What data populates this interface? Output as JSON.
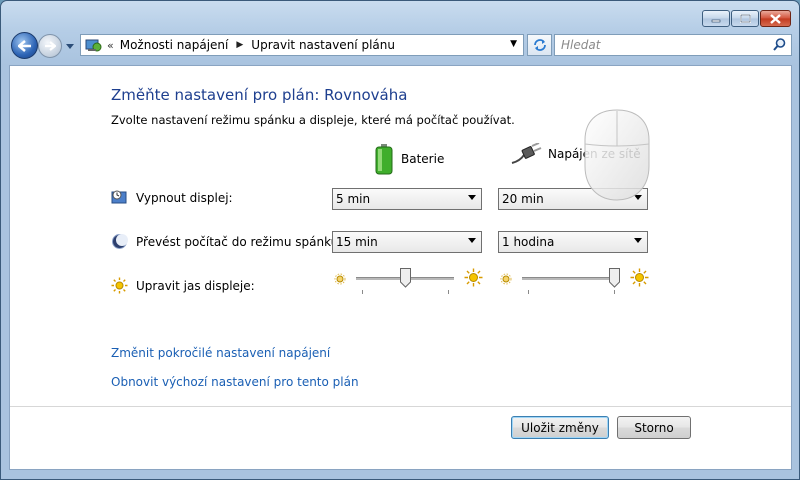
{
  "window": {
    "caption_buttons": [
      "minimize",
      "maximize",
      "close"
    ]
  },
  "navbar": {
    "address": {
      "overflow": "«",
      "crumbs": [
        "Možnosti napájení",
        "Upravit nastavení plánu"
      ]
    },
    "search_placeholder": "Hledat"
  },
  "main": {
    "title": "Změňte nastavení pro plán: Rovnováha",
    "subtitle": "Zvolte nastavení režimu spánku a displeje, které má počítač používat.",
    "columns": {
      "battery": "Baterie",
      "plugged_in": "Napájen ze sítě"
    },
    "rows": {
      "display_off": {
        "label": "Vypnout displej:",
        "battery_value": "5 min",
        "ac_value": "20 min"
      },
      "sleep": {
        "label": "Převést počítač do režimu spánku:",
        "battery_value": "15 min",
        "ac_value": "1 hodina"
      },
      "brightness": {
        "label": "Upravit jas displeje:",
        "battery_level": 0.5,
        "ac_level": 1.0
      }
    },
    "links": {
      "advanced": "Změnit pokročilé nastavení napájení",
      "restore": "Obnovit výchozí nastavení pro tento plán"
    },
    "buttons": {
      "save": "Uložit změny",
      "cancel": "Storno"
    }
  },
  "colors": {
    "title": "#1e3f8f",
    "link": "#1a5fb4",
    "window_frame": "#b5cde6"
  }
}
